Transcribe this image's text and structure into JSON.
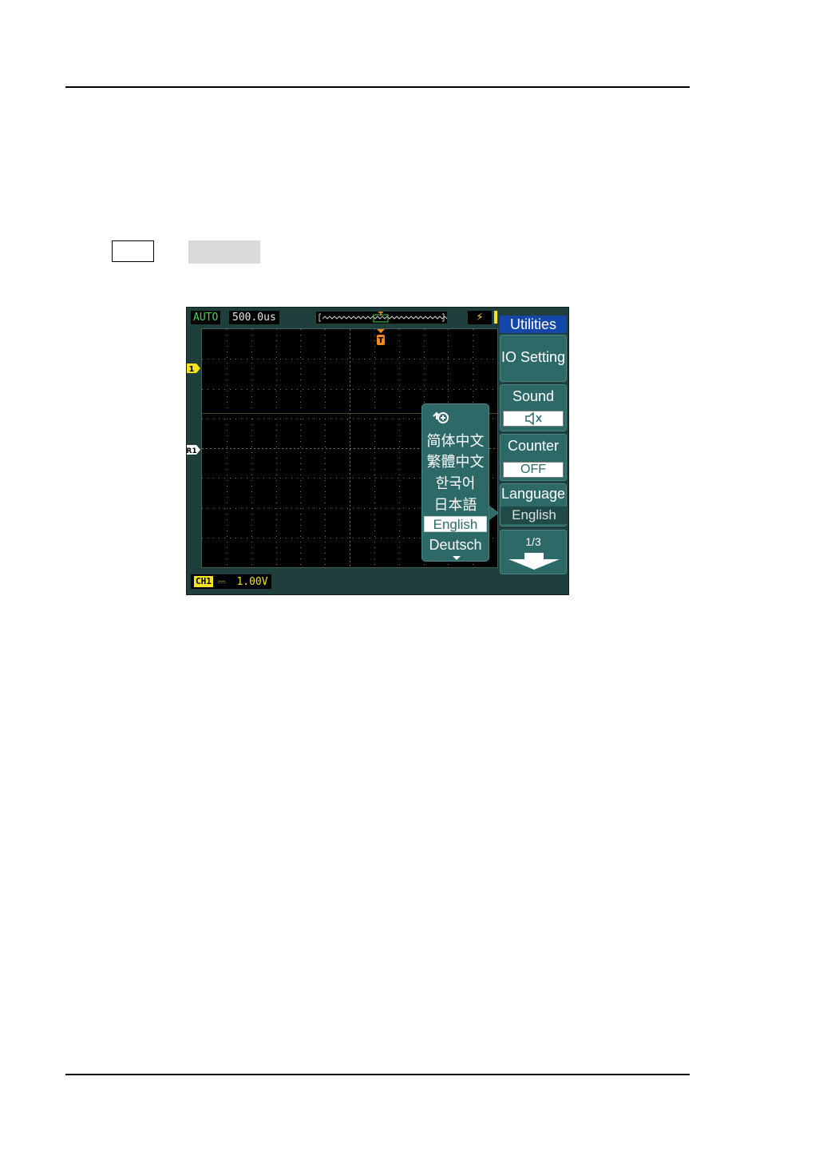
{
  "scope": {
    "status": {
      "mode": "AUTO",
      "timebase": "500.0us"
    },
    "channel_status": {
      "tag": "CH1",
      "coupling": "DC",
      "scale": "1.00V"
    },
    "markers": {
      "ch1": "1",
      "ref": "R1",
      "trigger": "T"
    },
    "language_popup": {
      "items": [
        "简体中文",
        "繁體中文",
        "한국어",
        "日本語",
        "English",
        "Deutsch"
      ],
      "selected": "English"
    },
    "menu": {
      "title": "Utilities",
      "io_setting": "IO Setting",
      "sound": {
        "label": "Sound",
        "state": "muted"
      },
      "counter": {
        "label": "Counter",
        "value": "OFF"
      },
      "language": {
        "label": "Language",
        "value": "English"
      },
      "page": "1/3"
    },
    "colors": {
      "screen_bg": "#1e3f3c",
      "menu_bg": "#2c6967",
      "title_bar": "#1447a8",
      "channel1": "#f6e219",
      "trigger": "#f08a1e",
      "status_green": "#46d846"
    }
  }
}
